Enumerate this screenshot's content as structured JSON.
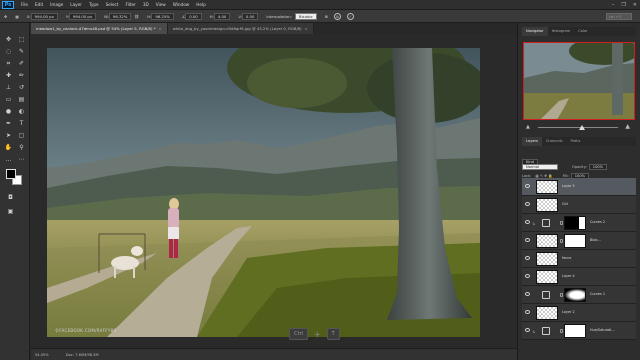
{
  "app": {
    "logo": "Ps"
  },
  "menu": [
    "File",
    "Edit",
    "Image",
    "Layer",
    "Type",
    "Select",
    "Filter",
    "3D",
    "View",
    "Window",
    "Help"
  ],
  "window_controls": {
    "minimize": "–",
    "restore": "❐",
    "close": "✕"
  },
  "options_bar": {
    "x_label": "X:",
    "x_value": "994.00 px",
    "y_label": "Y:",
    "y_value": "994.00 px",
    "w_label": "W:",
    "w_value": "96.32%",
    "h_label": "H:",
    "h_value": "96.25%",
    "angle_value": "0.00",
    "hskew_label": "H:",
    "hskew_value": "4.00",
    "vskew_label": "V:",
    "vskew_value": "0.00",
    "interpolation_label": "Interpolation:",
    "interpolation_value": "Bicubic",
    "search_placeholder": "ctrl + F"
  },
  "tabs": [
    {
      "label": "meadow1_by_canlock-d7dmu48.psd @ 54% (Layer 5, RGB/8) *",
      "active": true
    },
    {
      "label": "white_dog_by_yoomidesign-d3d6qrf9.jpg @ 43.2% (Layer 0, RGB/8)",
      "active": false
    }
  ],
  "tab_close": "×",
  "canvas": {
    "watermark": "©FACEBOOK.COM/RAFFY89"
  },
  "key_hint": {
    "key": "Ctrl",
    "plus": "+",
    "key2": "T"
  },
  "status": {
    "zoom": "54.05%",
    "doc": "Doc: 7.60M/98.3M"
  },
  "navigator": {
    "tabs": [
      "Navigator",
      "Histogram",
      "Color"
    ],
    "zoom_level": 0.55
  },
  "layers_panel": {
    "tabs": [
      "Layers",
      "Channels",
      "Paths"
    ],
    "kind_label": "Kind",
    "blend_mode": "Normal",
    "opacity_label": "Opacity:",
    "opacity_value": "100%",
    "lock_label": "Lock:",
    "fill_label": "Fill:",
    "fill_value": "100%",
    "layers": [
      {
        "name": "Layer 5",
        "type": "pixel",
        "selected": true
      },
      {
        "name": "Girl",
        "type": "pixel",
        "selected": false
      },
      {
        "name": "Curves 2",
        "type": "adjustment",
        "selected": false
      },
      {
        "name": "Blob...",
        "type": "pixel-mask",
        "selected": false
      },
      {
        "name": "fence",
        "type": "pixel",
        "selected": false
      },
      {
        "name": "Layer 4",
        "type": "pixel",
        "selected": false
      },
      {
        "name": "Curves 1",
        "type": "adjustment",
        "selected": false
      },
      {
        "name": "Layer 2",
        "type": "pixel",
        "selected": false
      },
      {
        "name": "Hue/Saturati...",
        "type": "adjustment",
        "selected": false
      }
    ]
  }
}
